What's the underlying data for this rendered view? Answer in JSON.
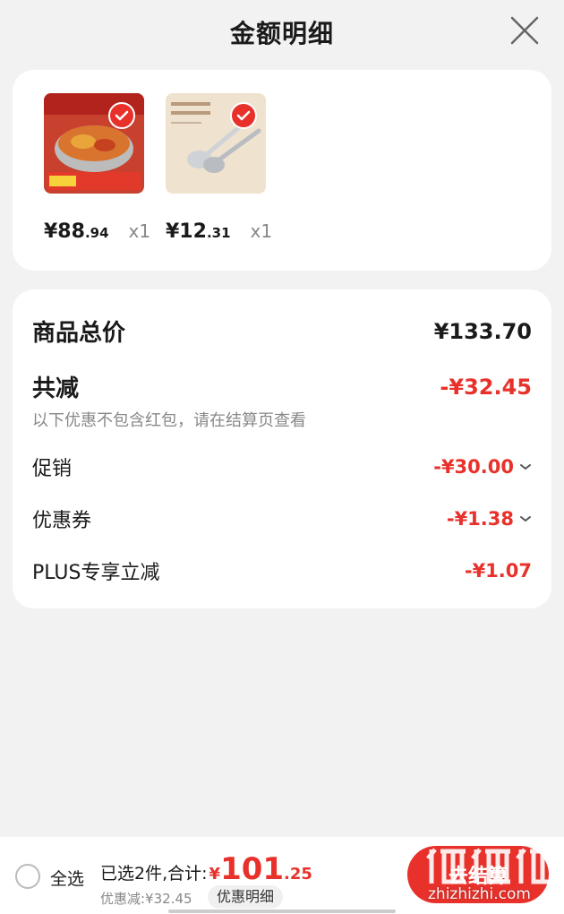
{
  "header": {
    "title": "金额明细",
    "close_icon": "close-icon"
  },
  "products": [
    {
      "name": "hotpot-pot",
      "price_int": "¥88",
      "price_dec": ".94",
      "qty": "x1",
      "checked": true
    },
    {
      "name": "spoon-set",
      "price_int": "¥12",
      "price_dec": ".31",
      "qty": "x1",
      "checked": true
    }
  ],
  "detail": {
    "total_label": "商品总价",
    "total_value": "¥133.70",
    "reduce_label": "共减",
    "reduce_value": "-¥32.45",
    "note": "以下优惠不包含红包，请在结算页查看",
    "items": [
      {
        "label": "促销",
        "value": "-¥30.00",
        "expandable": true
      },
      {
        "label": "优惠券",
        "value": "-¥1.38",
        "expandable": true
      },
      {
        "label": "PLUS专享立减",
        "value": "-¥1.07",
        "expandable": false
      }
    ]
  },
  "footer": {
    "select_all": "全选",
    "summary": "已选2件,合计:",
    "total_symbol": "¥",
    "total_int": "101",
    "total_dec": ".25",
    "discount": "优惠减:¥32.45",
    "detail_link": "优惠明细",
    "checkout": "去结算"
  },
  "watermark": {
    "text": "zhizhizhi.com"
  },
  "colors": {
    "accent": "#e8312b",
    "muted": "#888888",
    "background": "#f2f2f2"
  }
}
